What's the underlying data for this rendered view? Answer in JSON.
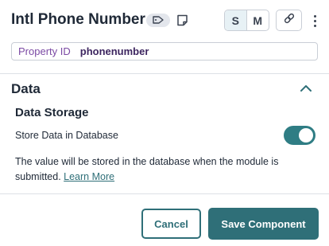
{
  "header": {
    "title": "Intl Phone Number",
    "icons": {
      "tag": "tag-icon",
      "note": "note-icon",
      "link": "link-icon",
      "more": "more-vertical-icon"
    },
    "size_options": [
      "S",
      "M"
    ],
    "selected_size": "S"
  },
  "property": {
    "label": "Property ID",
    "value": "phonenumber"
  },
  "section": {
    "title": "Data",
    "expanded": true,
    "icon": "chevron-up-icon",
    "group_title": "Data Storage",
    "toggle_label": "Store Data in Database",
    "toggle_on": true,
    "help_text": "The value will be stored in the database when the module is submitted.",
    "learn_more": "Learn More"
  },
  "footer": {
    "cancel_label": "Cancel",
    "save_label": "Save Component"
  },
  "colors": {
    "accent": "#2f6f78",
    "toggle_on": "#2f7d84",
    "property_label": "#7b4aa4"
  }
}
